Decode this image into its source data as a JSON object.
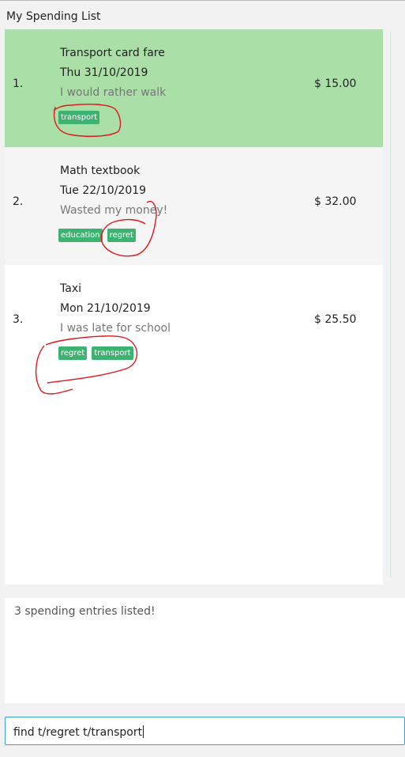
{
  "list": {
    "title": "My Spending List",
    "entries": [
      {
        "index": "1.",
        "description": "Transport card fare",
        "date": "Thu 31/10/2019",
        "remark": "I would rather walk",
        "tags": [
          "transport"
        ],
        "amount": "$ 15.00"
      },
      {
        "index": "2.",
        "description": "Math textbook",
        "date": "Tue 22/10/2019",
        "remark": "Wasted my money!",
        "tags": [
          "education",
          "regret"
        ],
        "amount": "$ 32.00"
      },
      {
        "index": "3.",
        "description": "Taxi",
        "date": "Mon 21/10/2019",
        "remark": "I was late for school",
        "tags": [
          "regret",
          "transport"
        ],
        "amount": "$ 25.50"
      }
    ]
  },
  "result": {
    "message": "3 spending entries listed!"
  },
  "command": {
    "value": "find t/regret t/transport"
  },
  "colors": {
    "selected_row": "#aadfa7",
    "tag": "#3cb371",
    "annotation": "#e0161c",
    "command_border": "#3aa0d8"
  }
}
